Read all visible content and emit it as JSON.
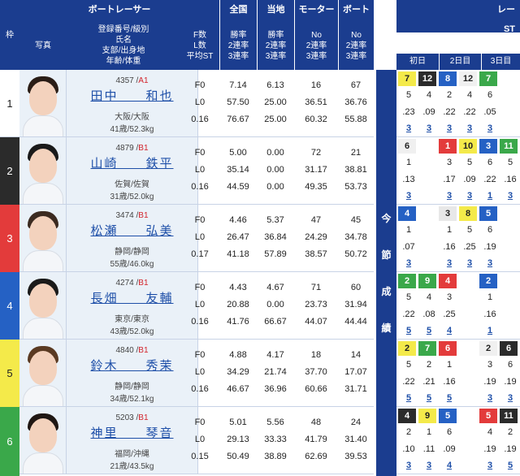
{
  "header": {
    "frame": "枠",
    "boatracer": "ボートレーサー",
    "photo": "写真",
    "info_lines": [
      "登録番号/級別",
      "氏名",
      "支部/出身地",
      "年齢/体重"
    ],
    "st_lines": [
      "F数",
      "L数",
      "平均ST"
    ],
    "national": "全国",
    "national_lines": [
      "勝率",
      "2連率",
      "3連率"
    ],
    "local": "当地",
    "local_lines": [
      "勝率",
      "2連率",
      "3連率"
    ],
    "motor": "モーター",
    "motor_lines": [
      "No",
      "2連率",
      "3連率"
    ],
    "boat": "ボート",
    "boat_lines": [
      "No",
      "2連率",
      "3連率"
    ],
    "right_top": "レー",
    "right_sub": "ST",
    "days": [
      "初日",
      "2日目",
      "3日目"
    ]
  },
  "vertical_label": [
    "今",
    "節",
    "成",
    "績"
  ],
  "colors": {
    "header_blue": "#1b3d8f",
    "link_blue": "#1e4fa8",
    "class_red": "#d3232b"
  },
  "racers": [
    {
      "frame": "1",
      "reg": "4357 /",
      "cls": "A1",
      "name": "田中　　和也",
      "pref": "大阪/大阪",
      "age": "41歳/52.3kg",
      "st": [
        "F0",
        "L0",
        "0.16"
      ],
      "national": [
        "7.14",
        "57.50",
        "76.67"
      ],
      "local": [
        "6.13",
        "25.00",
        "25.00"
      ],
      "motor": [
        "16",
        "36.51",
        "60.32"
      ],
      "boat": [
        "67",
        "36.76",
        "55.88"
      ]
    },
    {
      "frame": "2",
      "reg": "4879 /",
      "cls": "B1",
      "name": "山崎　　鉄平",
      "pref": "佐賀/佐賀",
      "age": "31歳/52.0kg",
      "st": [
        "F0",
        "L0",
        "0.16"
      ],
      "national": [
        "5.00",
        "35.14",
        "44.59"
      ],
      "local": [
        "0.00",
        "0.00",
        "0.00"
      ],
      "motor": [
        "72",
        "31.17",
        "49.35"
      ],
      "boat": [
        "21",
        "38.81",
        "53.73"
      ]
    },
    {
      "frame": "3",
      "reg": "3474 /",
      "cls": "B1",
      "name": "松瀬　　弘美",
      "pref": "静岡/静岡",
      "age": "55歳/46.0kg",
      "st": [
        "F0",
        "L0",
        "0.17"
      ],
      "national": [
        "4.46",
        "26.47",
        "41.18"
      ],
      "local": [
        "5.37",
        "36.84",
        "57.89"
      ],
      "motor": [
        "47",
        "24.29",
        "38.57"
      ],
      "boat": [
        "45",
        "34.78",
        "50.72"
      ]
    },
    {
      "frame": "4",
      "reg": "4274 /",
      "cls": "B1",
      "name": "長畑　　友輔",
      "pref": "東京/東京",
      "age": "43歳/52.0kg",
      "st": [
        "F0",
        "L0",
        "0.16"
      ],
      "national": [
        "4.43",
        "20.88",
        "41.76"
      ],
      "local": [
        "4.67",
        "0.00",
        "66.67"
      ],
      "motor": [
        "71",
        "23.73",
        "44.07"
      ],
      "boat": [
        "60",
        "31.94",
        "44.44"
      ]
    },
    {
      "frame": "5",
      "reg": "4840 /",
      "cls": "B1",
      "name": "鈴木　　秀茉",
      "pref": "静岡/静岡",
      "age": "34歳/52.1kg",
      "st": [
        "F0",
        "L0",
        "0.16"
      ],
      "national": [
        "4.88",
        "34.29",
        "46.67"
      ],
      "local": [
        "4.17",
        "21.74",
        "36.96"
      ],
      "motor": [
        "18",
        "37.70",
        "60.66"
      ],
      "boat": [
        "14",
        "17.07",
        "31.71"
      ]
    },
    {
      "frame": "6",
      "reg": "5203 /",
      "cls": "B1",
      "name": "神里　　琴音",
      "pref": "福岡/沖縄",
      "age": "21歳/43.5kg",
      "st": [
        "F0",
        "L0",
        "0.15"
      ],
      "national": [
        "5.01",
        "29.13",
        "50.49"
      ],
      "local": [
        "5.56",
        "33.33",
        "38.89"
      ],
      "motor": [
        "48",
        "41.79",
        "62.69"
      ],
      "boat": [
        "24",
        "31.40",
        "39.53"
      ]
    }
  ],
  "results": [
    {
      "cells": [
        [
          "7",
          "5",
          ".23",
          "3"
        ],
        [
          "12",
          "4",
          ".09",
          "3"
        ],
        [
          "8",
          "2",
          ".22",
          "3"
        ],
        [
          "12",
          "4",
          ".22",
          "3"
        ],
        [
          "7",
          "6",
          ".05",
          "3"
        ]
      ]
    },
    {
      "cells": [
        [
          "6",
          "1",
          ".13",
          "3"
        ],
        [
          "",
          "",
          "",
          " "
        ],
        [
          "1",
          "3",
          ".17",
          "3"
        ],
        [
          "10",
          "5",
          ".09",
          "3"
        ],
        [
          "3",
          "6",
          ".22",
          "1"
        ],
        [
          "11",
          "5",
          ".16",
          "3"
        ]
      ]
    },
    {
      "cells": [
        [
          "4",
          "1",
          ".07",
          "3"
        ],
        [
          "",
          "",
          "",
          " "
        ],
        [
          "3",
          "1",
          ".16",
          "3"
        ],
        [
          "8",
          "5",
          ".25",
          "3"
        ],
        [
          "5",
          "6",
          ".19",
          "3"
        ]
      ]
    },
    {
      "cells": [
        [
          "2",
          "5",
          ".22",
          "5"
        ],
        [
          "9",
          "4",
          ".08",
          "5"
        ],
        [
          "4",
          "3",
          ".25",
          "4"
        ],
        [
          "",
          "",
          "",
          " "
        ],
        [
          "2",
          "1",
          ".16",
          "1"
        ]
      ]
    },
    {
      "cells": [
        [
          "2",
          "5",
          ".22",
          "5"
        ],
        [
          "7",
          "2",
          ".21",
          "5"
        ],
        [
          "6",
          "1",
          ".16",
          "5"
        ],
        [
          "",
          "",
          "",
          " "
        ],
        [
          "2",
          "3",
          ".19",
          "3"
        ],
        [
          "6",
          "6",
          ".19",
          "3"
        ]
      ]
    },
    {
      "cells": [
        [
          "4",
          "2",
          ".10",
          "3"
        ],
        [
          "9",
          "1",
          ".11",
          "3"
        ],
        [
          "5",
          "6",
          ".09",
          "4"
        ],
        [
          "",
          "",
          "",
          " "
        ],
        [
          "5",
          "4",
          ".19",
          "3"
        ],
        [
          "11",
          "2",
          ".19",
          "5"
        ]
      ]
    }
  ]
}
